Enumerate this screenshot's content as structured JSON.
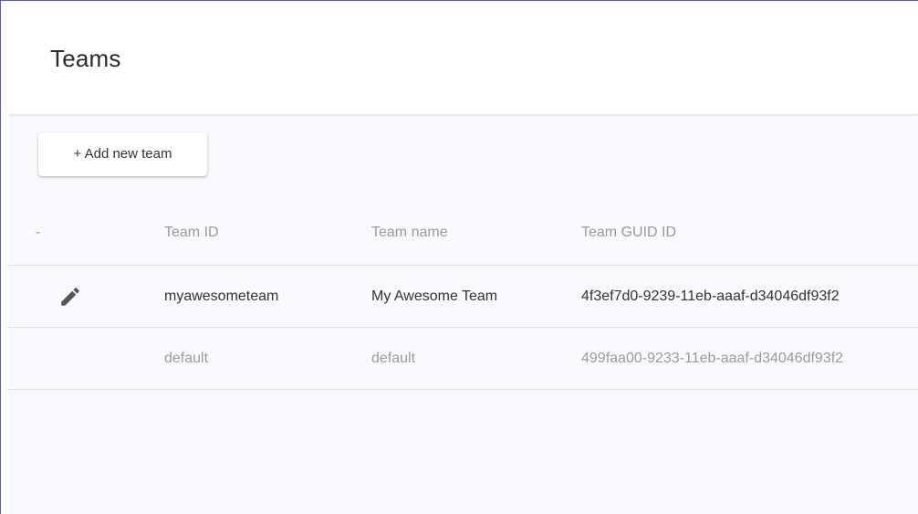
{
  "header": {
    "title": "Teams"
  },
  "toolbar": {
    "add_label": "+ Add new team"
  },
  "table": {
    "columns": {
      "action": "-",
      "team_id": "Team ID",
      "team_name": "Team name",
      "team_guid": "Team GUID ID"
    },
    "rows": [
      {
        "team_id": "myawesometeam",
        "team_name": "My Awesome Team",
        "team_guid": "4f3ef7d0-9239-11eb-aaaf-d34046df93f2",
        "icon": "edit-icon"
      },
      {
        "team_id": "default",
        "team_name": "default",
        "team_guid": "499faa00-9233-11eb-aaaf-d34046df93f2"
      }
    ]
  },
  "colors": {
    "frame_border": "#5b5f9c",
    "content_background": "#f7f9fc",
    "muted_text": "#9b9b9b"
  }
}
